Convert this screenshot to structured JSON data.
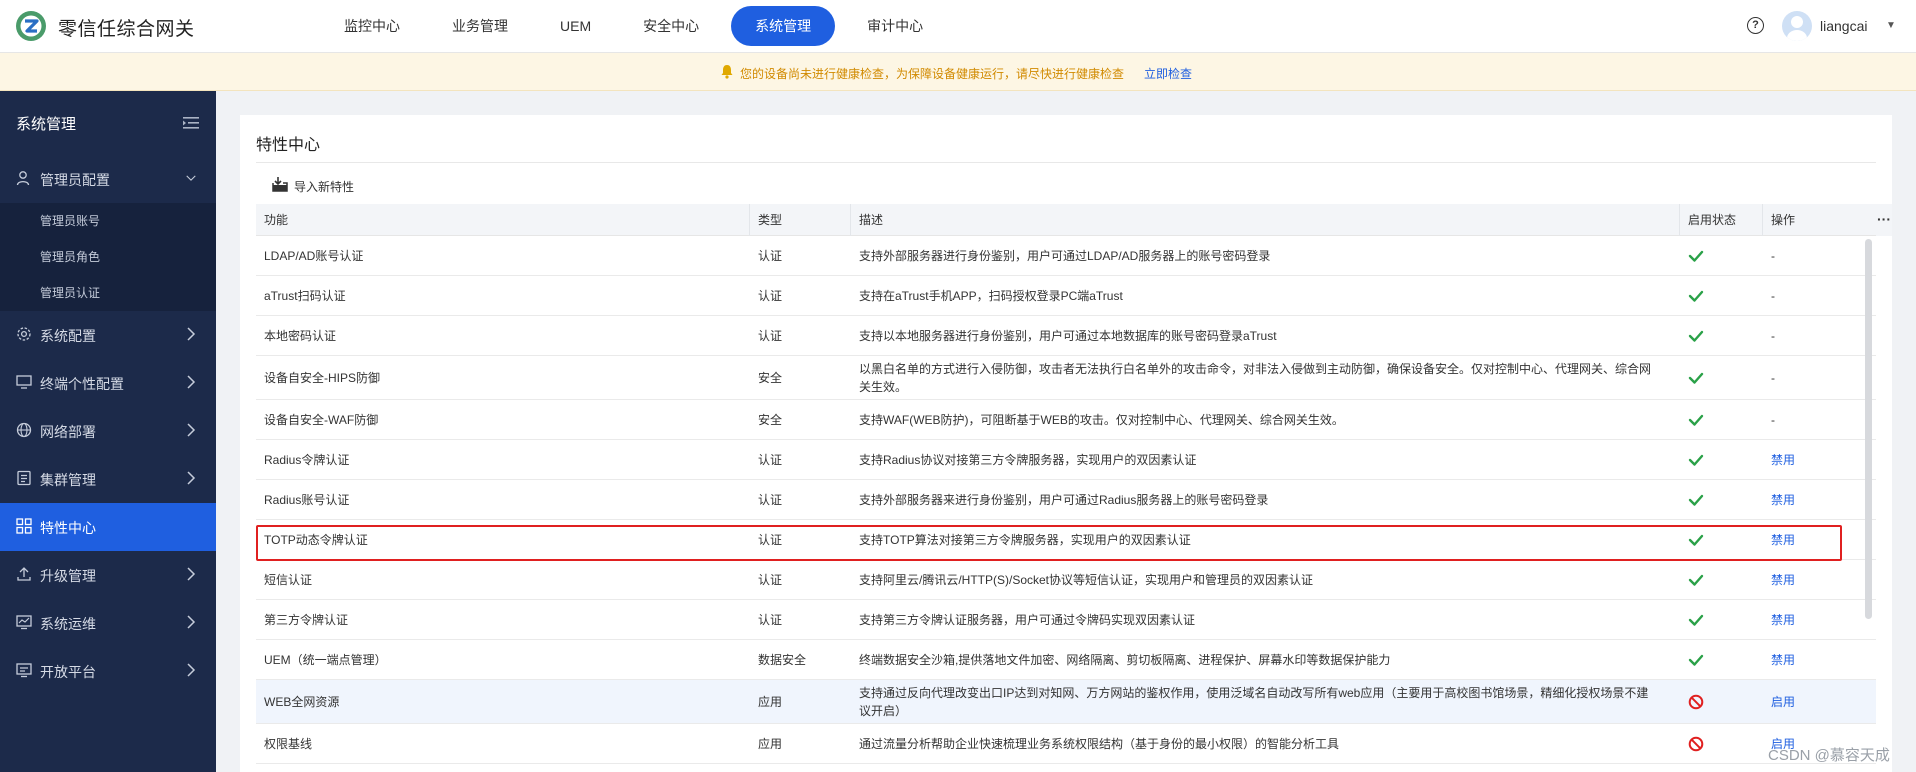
{
  "header": {
    "brand": "零信任综合网关",
    "nav": [
      "监控中心",
      "业务管理",
      "UEM",
      "安全中心",
      "系统管理",
      "审计中心"
    ],
    "active_nav": "系统管理",
    "help_glyph": "?",
    "username": "liangcai"
  },
  "notice": {
    "text": "您的设备尚未进行健康检查，为保障设备健康运行，请尽快进行健康检查",
    "link": "立即检查"
  },
  "sidebar": {
    "title": "系统管理",
    "groups": [
      {
        "label": "管理员配置",
        "icon": "user-icon",
        "expanded": true
      },
      {
        "label": "系统配置",
        "icon": "gear-icon"
      },
      {
        "label": "终端个性配置",
        "icon": "monitor-icon"
      },
      {
        "label": "网络部署",
        "icon": "globe-icon"
      },
      {
        "label": "集群管理",
        "icon": "cluster-icon"
      },
      {
        "label": "特性中心",
        "icon": "grid-icon",
        "active": true
      },
      {
        "label": "升级管理",
        "icon": "upload-icon"
      },
      {
        "label": "系统运维",
        "icon": "chart-icon"
      },
      {
        "label": "开放平台",
        "icon": "platform-icon"
      }
    ],
    "subitems": [
      "管理员账号",
      "管理员角色",
      "管理员认证"
    ]
  },
  "main": {
    "title": "特性中心",
    "import_label": "导入新特性",
    "columns": [
      "功能",
      "类型",
      "描述",
      "启用状态",
      "操作"
    ],
    "more_glyph": "···",
    "rows": [
      {
        "name": "LDAP/AD账号认证",
        "type": "认证",
        "desc": "支持外部服务器进行身份鉴别，用户可通过LDAP/AD服务器上的账号密码登录",
        "status": "enabled",
        "op": "-"
      },
      {
        "name": "aTrust扫码认证",
        "type": "认证",
        "desc": "支持在aTrust手机APP，扫码授权登录PC端aTrust",
        "status": "enabled",
        "op": "-"
      },
      {
        "name": "本地密码认证",
        "type": "认证",
        "desc": "支持以本地服务器进行身份鉴别，用户可通过本地数据库的账号密码登录aTrust",
        "status": "enabled",
        "op": "-"
      },
      {
        "name": "设备自安全-HIPS防御",
        "type": "安全",
        "desc": "以黑白名单的方式进行入侵防御，攻击者无法执行白名单外的攻击命令，对非法入侵做到主动防御，确保设备安全。仅对控制中心、代理网关、综合网关生效。",
        "status": "enabled",
        "op": "-"
      },
      {
        "name": "设备自安全-WAF防御",
        "type": "安全",
        "desc": "支持WAF(WEB防护)，可阻断基于WEB的攻击。仅对控制中心、代理网关、综合网关生效。",
        "status": "enabled",
        "op": "-"
      },
      {
        "name": "Radius令牌认证",
        "type": "认证",
        "desc": "支持Radius协议对接第三方令牌服务器，实现用户的双因素认证",
        "status": "enabled",
        "op": "禁用"
      },
      {
        "name": "Radius账号认证",
        "type": "认证",
        "desc": "支持外部服务器来进行身份鉴别，用户可通过Radius服务器上的账号密码登录",
        "status": "enabled",
        "op": "禁用"
      },
      {
        "name": "TOTP动态令牌认证",
        "type": "认证",
        "desc": "支持TOTP算法对接第三方令牌服务器，实现用户的双因素认证",
        "status": "enabled",
        "op": "禁用"
      },
      {
        "name": "短信认证",
        "type": "认证",
        "desc": "支持阿里云/腾讯云/HTTP(S)/Socket协议等短信认证，实现用户和管理员的双因素认证",
        "status": "enabled",
        "op": "禁用"
      },
      {
        "name": "第三方令牌认证",
        "type": "认证",
        "desc": "支持第三方令牌认证服务器，用户可通过令牌码实现双因素认证",
        "status": "enabled",
        "op": "禁用"
      },
      {
        "name": "UEM（统一端点管理）",
        "type": "数据安全",
        "desc": "终端数据安全沙箱,提供落地文件加密、网络隔离、剪切板隔离、进程保护、屏幕水印等数据保护能力",
        "status": "enabled",
        "op": "禁用"
      },
      {
        "name": "WEB全网资源",
        "type": "应用",
        "desc": "支持通过反向代理改变出口IP达到对知网、万方网站的鉴权作用，使用泛域名自动改写所有web应用（主要用于高校图书馆场景，精细化授权场景不建议开启）",
        "status": "disabled",
        "op": "启用"
      },
      {
        "name": "权限基线",
        "type": "应用",
        "desc": "通过流量分析帮助企业快速梳理业务系统权限结构（基于身份的最小权限）的智能分析工具",
        "status": "disabled",
        "op": "启用"
      }
    ]
  },
  "watermark": "CSDN @慕容天成",
  "colors": {
    "accent": "#1f5fe0",
    "sidebar_bg": "#1c2a4a",
    "enabled": "#2aa148",
    "disabled": "#e02020",
    "highlight_box": "#e02020"
  }
}
